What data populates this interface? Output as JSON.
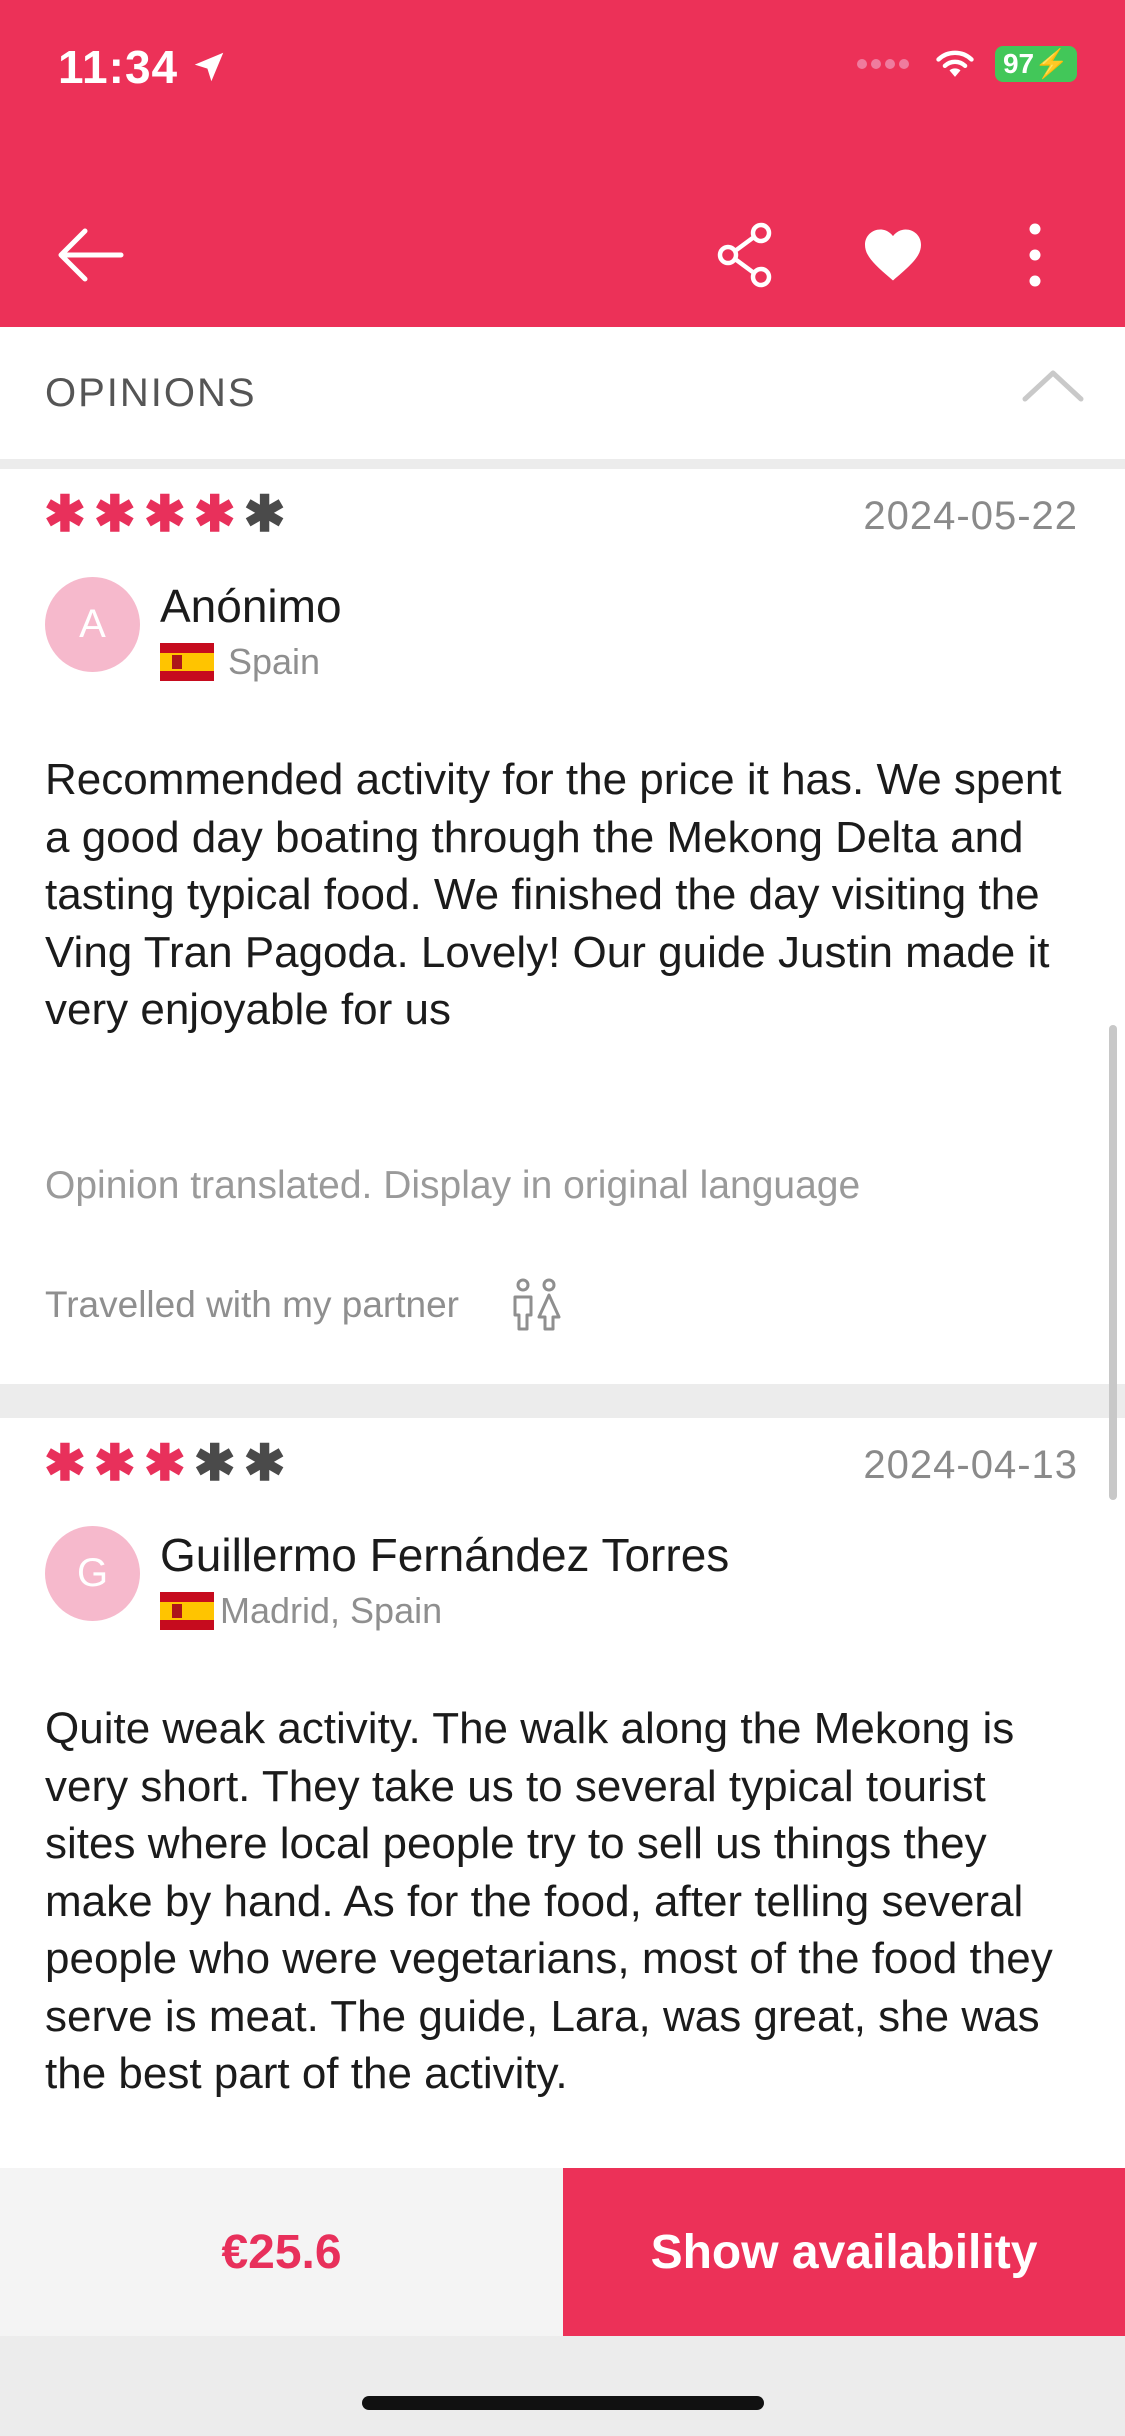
{
  "status_bar": {
    "time": "11:34",
    "battery": "97"
  },
  "colors": {
    "accent": "#EC3158",
    "star_on": "#E8305B",
    "star_off": "#4a4a4a",
    "avatar": "#F6B9CC"
  },
  "toolbar": {
    "icons": [
      "back-arrow-icon",
      "share-icon",
      "heart-icon",
      "more-vertical-icon"
    ]
  },
  "section": {
    "title": "OPINIONS"
  },
  "reviews": [
    {
      "rating": 4,
      "date": "2024-05-22",
      "avatar_letter": "A",
      "name": "Anónimo",
      "location": "Spain",
      "text": "Recommended activity for the price it has. We spent a good day boating through the Mekong Delta and tasting typical food. We finished the day visiting the Ving Tran Pagoda. Lovely! Our guide Justin made it very enjoyable for us",
      "translated_note": "Opinion translated. Display in original language",
      "travelled": "Travelled with my partner"
    },
    {
      "rating": 3,
      "date": "2024-04-13",
      "avatar_letter": "G",
      "name": "Guillermo Fernández Torres",
      "location": "Madrid, Spain",
      "text": "Quite weak activity. The walk along the Mekong is very short. They take us to several typical tourist sites where local people try to sell us things they make by hand. As for the food, after telling several people who were vegetarians, most of the food they serve is meat. The guide, Lara, was great, she was the best part of the activity."
    }
  ],
  "footer": {
    "price": "€25.6",
    "cta": "Show availability"
  }
}
